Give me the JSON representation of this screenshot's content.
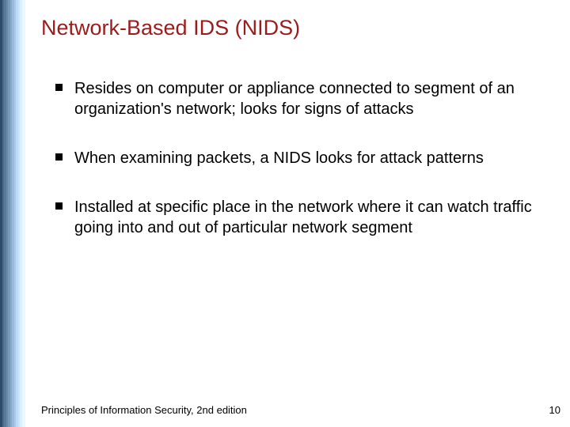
{
  "title": "Network-Based IDS (NIDS)",
  "bullets": [
    "Resides on computer or appliance connected to segment of an organization's network; looks for signs of attacks",
    "When examining packets, a NIDS looks for attack patterns",
    "Installed at specific place in the network where it can watch traffic going into and out of particular network segment"
  ],
  "footer": {
    "text": "Principles of Information Security, 2nd edition",
    "page": "10"
  }
}
